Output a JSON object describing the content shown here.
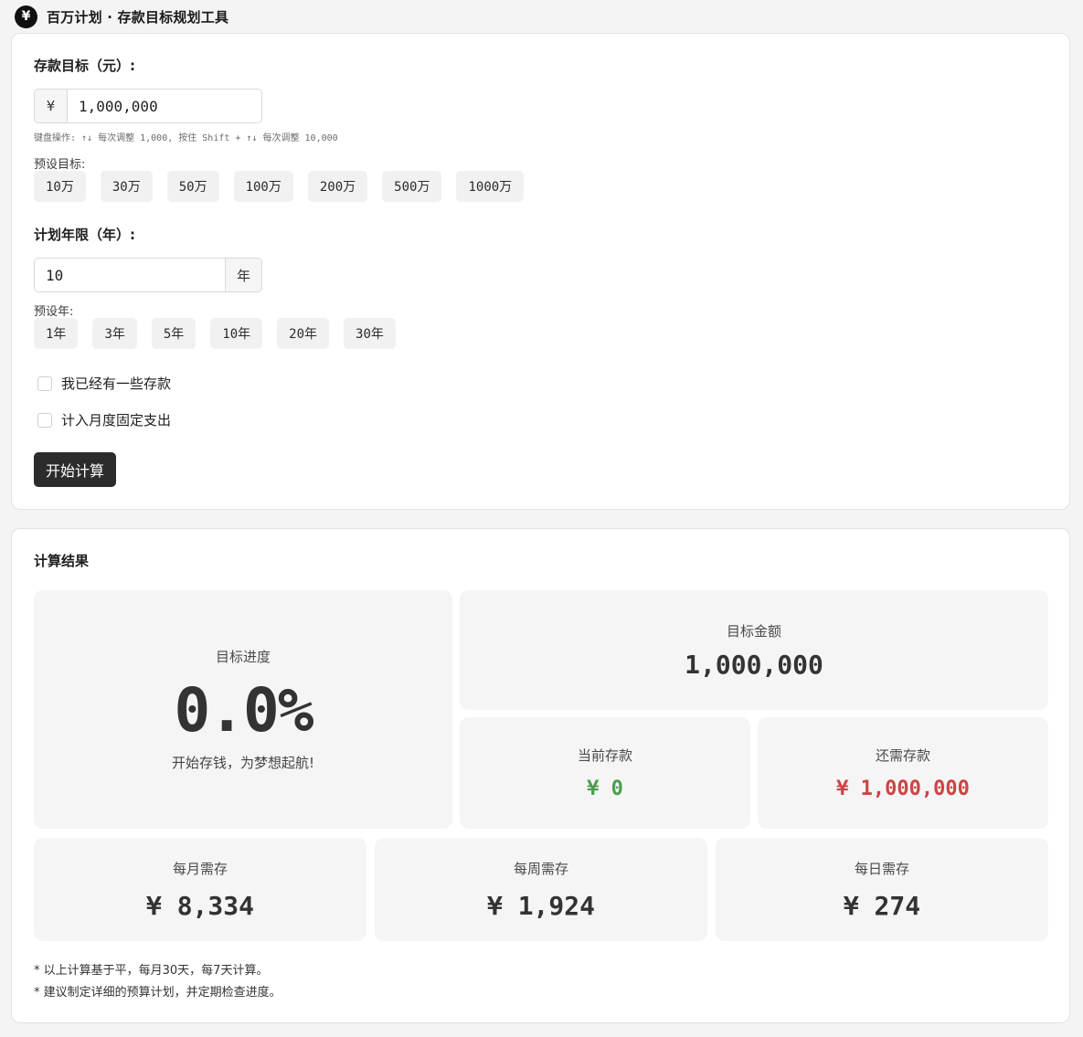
{
  "header": {
    "logo": "¥",
    "title": "百万计划 · 存款目标规划工具"
  },
  "goal": {
    "label": "存款目标（元）:",
    "currency": "¥",
    "value": "1,000,000",
    "hint": "键盘操作: ↑↓ 每次调整 1,000, 按住 Shift + ↑↓ 每次调整 10,000",
    "preset_label": "预设目标:",
    "presets": [
      "10万",
      "30万",
      "50万",
      "100万",
      "200万",
      "500万",
      "1000万"
    ]
  },
  "years": {
    "label": "计划年限（年）:",
    "value": "10",
    "unit": "年",
    "preset_label": "预设年:",
    "presets": [
      "1年",
      "3年",
      "5年",
      "10年",
      "20年",
      "30年"
    ]
  },
  "options": {
    "has_savings": {
      "label": "我已经有一些存款",
      "checked": false
    },
    "fixed_expense": {
      "label": "计入月度固定支出",
      "checked": false
    }
  },
  "actions": {
    "calculate_label": "开始计算"
  },
  "results": {
    "title": "计算结果",
    "progress": {
      "label": "目标进度",
      "value": "0.0%",
      "message": "开始存钱，为梦想起航!"
    },
    "target": {
      "label": "目标金额",
      "value": "1,000,000"
    },
    "current": {
      "label": "当前存款",
      "value": "¥ 0"
    },
    "remaining": {
      "label": "还需存款",
      "value": "¥ 1,000,000"
    },
    "monthly": {
      "label": "每月需存",
      "value": "¥ 8,334"
    },
    "weekly": {
      "label": "每周需存",
      "value": "¥ 1,924"
    },
    "daily": {
      "label": "每日需存",
      "value": "¥ 274"
    },
    "notes": [
      "* 以上计算基于平，每月30天，每7天计算。",
      "* 建议制定详细的预算计划，并定期检查进度。"
    ]
  },
  "colors": {
    "positive": "#4a9e4e",
    "negative": "#cc4444",
    "primary": "#2c2c2c"
  }
}
